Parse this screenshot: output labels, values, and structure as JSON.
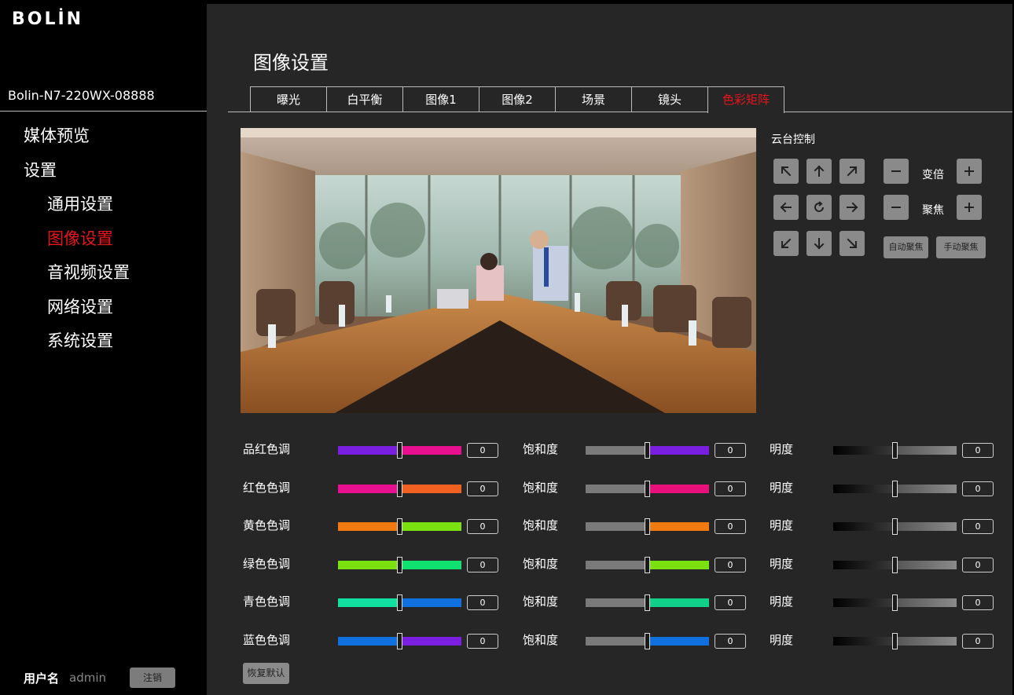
{
  "brand": "BOLİN",
  "device_name": "Bolin-N7-220WX-08888",
  "nav": [
    {
      "label": "媒体预览",
      "level": 1,
      "active": false,
      "name": "nav-media-preview"
    },
    {
      "label": "设置",
      "level": 1,
      "active": false,
      "name": "nav-settings"
    },
    {
      "label": "通用设置",
      "level": 2,
      "active": false,
      "name": "nav-general-settings"
    },
    {
      "label": "图像设置",
      "level": 2,
      "active": true,
      "name": "nav-image-settings"
    },
    {
      "label": "音视频设置",
      "level": 2,
      "active": false,
      "name": "nav-av-settings"
    },
    {
      "label": "网络设置",
      "level": 2,
      "active": false,
      "name": "nav-network-settings"
    },
    {
      "label": "系统设置",
      "level": 2,
      "active": false,
      "name": "nav-system-settings"
    }
  ],
  "user": {
    "label": "用户名",
    "name": "admin",
    "logout": "注销"
  },
  "page_title": "图像设置",
  "tabs": [
    {
      "label": "曝光",
      "active": false
    },
    {
      "label": "白平衡",
      "active": false
    },
    {
      "label": "图像1",
      "active": false
    },
    {
      "label": "图像2",
      "active": false
    },
    {
      "label": "场景",
      "active": false
    },
    {
      "label": "镜头",
      "active": false
    },
    {
      "label": "色彩矩阵",
      "active": true
    }
  ],
  "ptz": {
    "title": "云台控制",
    "zoom_label": "变倍",
    "focus_label": "聚焦",
    "auto_focus": "自动聚焦",
    "manual_focus": "手动聚焦"
  },
  "color_rows": [
    {
      "hue_label": "品红色调",
      "hue": "0",
      "sat_label": "饱和度",
      "sat": "0",
      "bri_label": "明度",
      "bri": "0",
      "hue_colors": [
        "#7a1fe0",
        "#e8108e"
      ],
      "sat_colors": [
        "#7a7a7a",
        "#7a1fe0"
      ]
    },
    {
      "hue_label": "红色色调",
      "hue": "0",
      "sat_label": "饱和度",
      "sat": "0",
      "bri_label": "明度",
      "bri": "0",
      "hue_colors": [
        "#e8108e",
        "#f06020"
      ],
      "sat_colors": [
        "#7a7a7a",
        "#e8107a"
      ]
    },
    {
      "hue_label": "黄色色调",
      "hue": "0",
      "sat_label": "饱和度",
      "sat": "0",
      "bri_label": "明度",
      "bri": "0",
      "hue_colors": [
        "#f07a10",
        "#7ae010"
      ],
      "sat_colors": [
        "#7a7a7a",
        "#f07a10"
      ]
    },
    {
      "hue_label": "绿色色调",
      "hue": "0",
      "sat_label": "饱和度",
      "sat": "0",
      "bri_label": "明度",
      "bri": "0",
      "hue_colors": [
        "#7ae010",
        "#10e070"
      ],
      "sat_colors": [
        "#7a7a7a",
        "#7ae010"
      ]
    },
    {
      "hue_label": "青色色调",
      "hue": "0",
      "sat_label": "饱和度",
      "sat": "0",
      "bri_label": "明度",
      "bri": "0",
      "hue_colors": [
        "#10e0a0",
        "#1070e0"
      ],
      "sat_colors": [
        "#7a7a7a",
        "#10d08a"
      ]
    },
    {
      "hue_label": "蓝色色调",
      "hue": "0",
      "sat_label": "饱和度",
      "sat": "0",
      "bri_label": "明度",
      "bri": "0",
      "hue_colors": [
        "#1070e0",
        "#7a1fe0"
      ],
      "sat_colors": [
        "#7a7a7a",
        "#1070e0"
      ]
    }
  ],
  "restore_default": "恢复默认",
  "colors": {
    "accent": "#e8141c",
    "panel": "#262626",
    "sidebar": "#000000",
    "button": "#8a8a8a"
  }
}
